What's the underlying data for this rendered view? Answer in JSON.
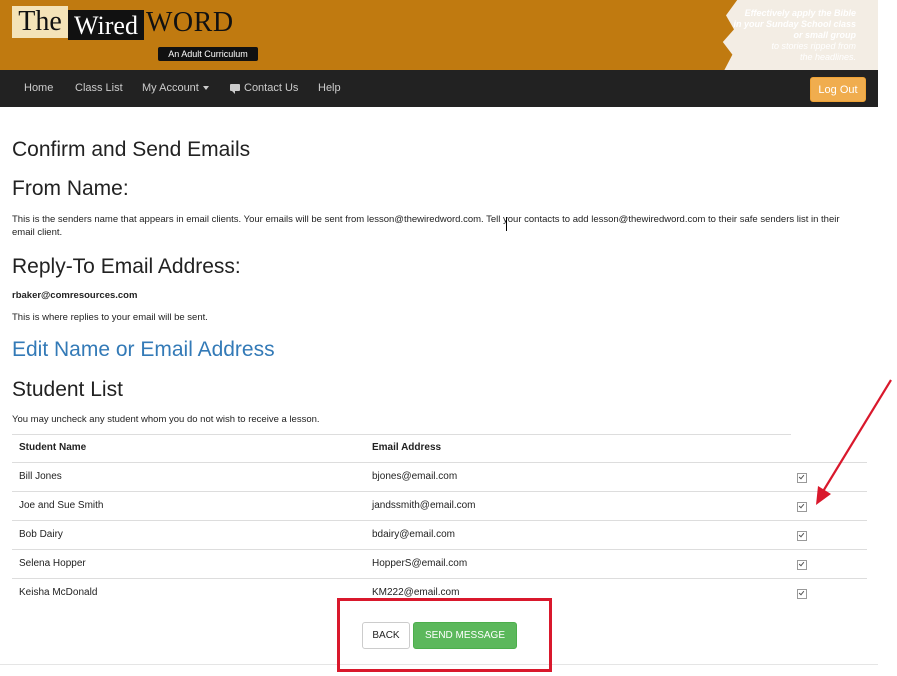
{
  "header": {
    "logo_the": "The",
    "logo_wired": "Wired",
    "logo_word": "WORD",
    "logo_subtitle": "An Adult Curriculum",
    "tagline_line1": "Effectively apply the Bible",
    "tagline_line2": "in your Sunday School class",
    "tagline_line3": "or small group",
    "tagline_line4": "to stories ripped from",
    "tagline_line5": "the headlines."
  },
  "nav": {
    "home": "Home",
    "class_list": "Class List",
    "my_account": "My Account",
    "contact_us": "Contact Us",
    "help": "Help",
    "logout": "Log Out"
  },
  "page": {
    "title": "Confirm and Send Emails",
    "from_heading": "From Name:",
    "from_text": "This is the senders name that appears in email clients. Your emails will be sent from lesson@thewiredword.com. Tell your contacts to add lesson@thewiredword.com to their safe senders list in their email client.",
    "reply_heading": "Reply-To Email Address:",
    "reply_email": "rbaker@comresources.com",
    "reply_text": "This is where replies to your email will be sent.",
    "edit_link": "Edit Name or Email Address",
    "student_heading": "Student List",
    "student_text": "You may uncheck any student whom you do not wish to receive a lesson."
  },
  "table": {
    "col_name": "Student Name",
    "col_email": "Email Address",
    "rows": [
      {
        "name": "Bill Jones",
        "email": "bjones@email.com",
        "checked": true
      },
      {
        "name": "Joe and Sue Smith",
        "email": "jandssmith@email.com",
        "checked": true
      },
      {
        "name": "Bob Dairy",
        "email": "bdairy@email.com",
        "checked": true
      },
      {
        "name": "Selena Hopper",
        "email": "HopperS@email.com",
        "checked": true
      },
      {
        "name": "Keisha McDonald",
        "email": "KM222@email.com",
        "checked": true
      }
    ]
  },
  "actions": {
    "back": "BACK",
    "send": "SEND MESSAGE"
  },
  "colors": {
    "banner": "#c07a10",
    "navbar": "#222222",
    "logout": "#f0ad4e",
    "send": "#5cb85c",
    "link": "#337ab7",
    "annotation": "#d9182c"
  }
}
